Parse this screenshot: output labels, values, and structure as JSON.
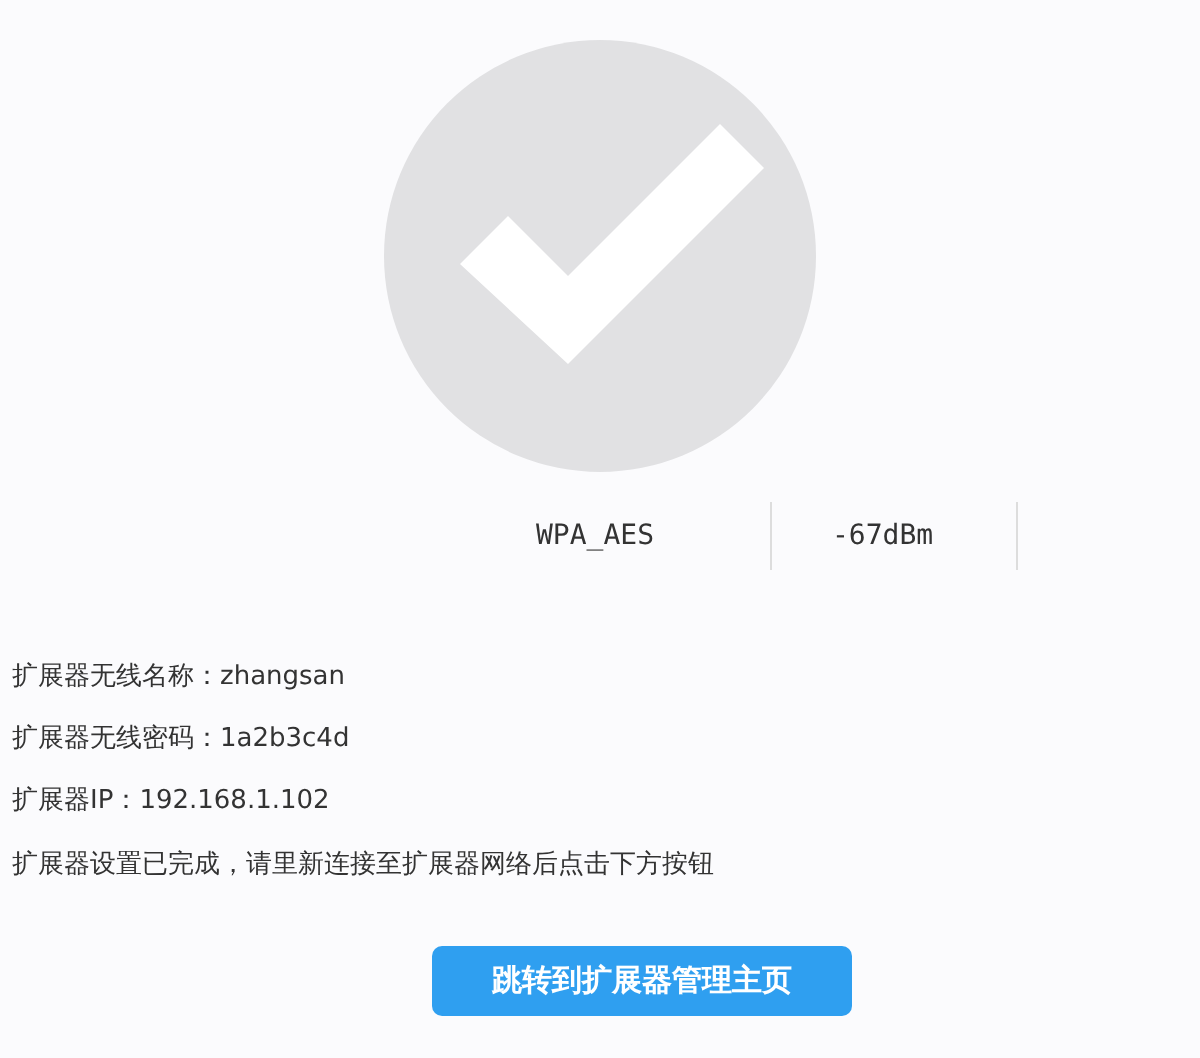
{
  "status": {
    "security": "WPA_AES",
    "signal": "-67dBm"
  },
  "info": [
    {
      "label": "扩展器无线名称：",
      "value": "zhangsan"
    },
    {
      "label": "扩展器无线密码：",
      "value": "1a2b3c4d"
    },
    {
      "label": "扩展器IP：",
      "value": "192.168.1.102"
    }
  ],
  "message": "扩展器设置已完成，请里新连接至扩展器网络后点击下方按钮",
  "button": "跳转到扩展器管理主页"
}
